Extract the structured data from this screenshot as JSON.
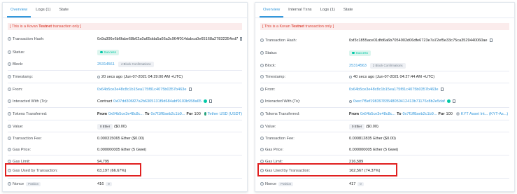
{
  "colors": {
    "accent": "#3498db",
    "success": "#00c9a7",
    "notice": "#de4437",
    "highlight": "#e02020"
  },
  "left": {
    "tabs": [
      "Overview",
      "Logs (1)",
      "State"
    ],
    "notice": {
      "prefix": "[ This is a Kovan ",
      "strong": "Testnet",
      "suffix": " transaction only ]"
    },
    "labels": {
      "hash": "Transaction Hash:",
      "status": "Status:",
      "block": "Block:",
      "timestamp": "Timestamp:",
      "from": "From:",
      "interacted": "Interacted With (To):",
      "tokens": "Tokens Transferred:",
      "value": "Value:",
      "fee": "Transaction Fee:",
      "gas_price": "Gas Price:",
      "gas_limit": "Gas Limit:",
      "gas_used": "Gas Used by Transaction:",
      "nonce": "Nonce"
    },
    "nonce_tag": "Position",
    "hash": "0x9a306e6b6fabe68b62a0a65dda5a66a3c964f014dabca0e65168a27832354ed7",
    "status": "Success",
    "block": "25314561",
    "block_conf": "4 Block Confirmations",
    "timestamp": "20 secs ago (Jun-07-2021 04:29:00 AM +UTC)",
    "from": "0x64b5ce3e48c8c1b15ea175f81c4075b0357b463e",
    "interacted_prefix": "Contract",
    "interacted": "0x07dd306f27a2b6305131f9d684abf9103b958a65",
    "token_from_label": "From",
    "token_from": "0x64b5ce3e48c8c...",
    "token_to_label": "To",
    "token_to": "0x7f1ff8aeb2c1b9...",
    "token_for": "For",
    "token_amount": "100",
    "token_name": "Tether USD (USDT)",
    "value": "0 Ether",
    "value_usd": "($0.00)",
    "fee": "0.000315065 Ether ($0.00)",
    "gas_price": "0.000000005 Ether (5 Gwei)",
    "gas_limit": "94,795",
    "gas_used": "63,197 (66.67%)",
    "nonce": "416",
    "nonce_badge": "9"
  },
  "right": {
    "tabs": [
      "Overview",
      "Internal Txns",
      "Logs (1)",
      "State"
    ],
    "notice": {
      "prefix": "[ This is a Kovan ",
      "strong": "Testnet",
      "suffix": " transaction only ]"
    },
    "labels": {
      "hash": "Transaction Hash:",
      "status": "Status:",
      "block": "Block:",
      "timestamp": "Timestamp:",
      "from": "From:",
      "interacted": "Interacted With (To):",
      "tokens": "Tokens Transferred:",
      "value": "Value:",
      "fee": "Transaction Fee:",
      "gas_price": "Gas Price:",
      "gas_limit": "Gas Limit:",
      "gas_used": "Gas Used by Transaction:",
      "nonce": "Nonce"
    },
    "nonce_tag": "Position",
    "hash": "0xf3c1855ace01dfd6a6b7054902d06dfe6723e7a72ef5e33c75ca3529440060ae",
    "status": "Success",
    "block": "25314563",
    "block_conf": "2 Block Confirmations",
    "timestamp": "40 secs ago (Jun-07-2021 04:27:44 AM +UTC)",
    "from": "0x64b5ce3e48c8c1b15ea175f81c4075b0357b463e",
    "interacted": "0xec7f5ef19839783548050412413b71176c8b2e5daf",
    "token_from_label": "From",
    "token_from": "0x64b5ce3e48c8c...",
    "token_to_label": "To",
    "token_to": "0x7f1ff8aeb2c1b9...",
    "token_for": "For",
    "token_amount": "100",
    "token_name": "KYT Asset Int... (KYT-As...)",
    "value": "0 Ether",
    "value_usd": "($0.00)",
    "fee": "0.000812835 Ether ($0.00)",
    "gas_price": "0.000000005 Ether (5 Gwei)",
    "gas_limit": "216,589",
    "gas_used": "162,567 (74.37%)",
    "nonce": "417",
    "nonce_badge": "0"
  }
}
